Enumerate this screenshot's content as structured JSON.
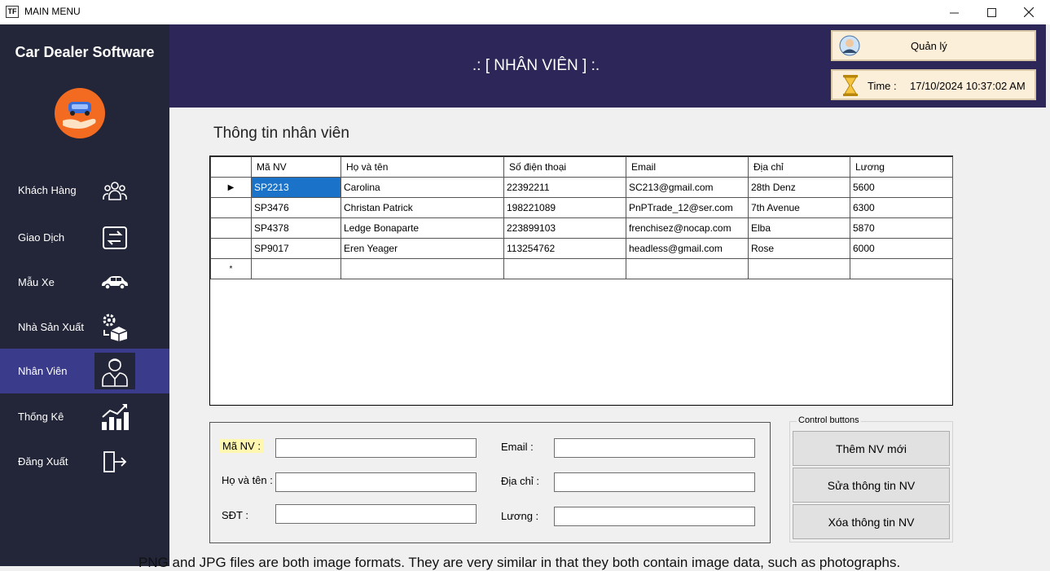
{
  "window": {
    "title": "MAIN MENU",
    "icon_label": "TF",
    "minimize": "—",
    "maximize": "☐",
    "close": "✕"
  },
  "sidebar": {
    "brand": "Car Dealer Software",
    "items": [
      {
        "label": "Khách Hàng",
        "icon": "customers-icon"
      },
      {
        "label": "Giao Dịch",
        "icon": "transactions-icon"
      },
      {
        "label": "Mẫu Xe",
        "icon": "car-icon"
      },
      {
        "label": "Nhà Sản Xuất",
        "icon": "manufacturer-icon"
      },
      {
        "label": "Nhân Viên",
        "icon": "employee-icon",
        "active": true
      },
      {
        "label": "Thống Kê",
        "icon": "statistics-icon"
      },
      {
        "label": "Đăng Xuất",
        "icon": "logout-icon"
      }
    ]
  },
  "header": {
    "title": ".: [ NHÂN VIÊN ] :.",
    "user_role": "Quản lý",
    "time_label": "Time :",
    "time_value": "17/10/2024 10:37:02 AM"
  },
  "main": {
    "section_title": "Thông tin nhân viên",
    "table": {
      "columns": [
        "Mã NV",
        "Họ và tên",
        "Số điện thoại",
        "Email",
        "Địa chỉ",
        "Lương"
      ],
      "rows": [
        [
          "SP2213",
          "Carolina",
          "22392211",
          "SC213@gmail.com",
          "28th Denz",
          "5600"
        ],
        [
          "SP3476",
          "Christan Patrick",
          "198221089",
          "PnPTrade_12@ser.com",
          "7th Avenue",
          "6300"
        ],
        [
          "SP4378",
          "Ledge Bonaparte",
          "223899103",
          "frenchisez@nocap.com",
          "Elba",
          "5870"
        ],
        [
          "SP9017",
          "Eren Yeager",
          "113254762",
          "headless@gmail.com",
          "Rose",
          "6000"
        ]
      ],
      "current_row_marker": "▶",
      "new_row_marker": "*"
    }
  },
  "form": {
    "ma_nv_label": "Mã NV :",
    "ho_ten_label": "Họ và tên :",
    "sdt_label": "SĐT :",
    "email_label": "Email :",
    "dia_chi_label": "Địa chỉ :",
    "luong_label": "Lương :"
  },
  "controls": {
    "legend": "Control buttons",
    "add": "Thêm NV mới",
    "edit": "Sửa thông tin NV",
    "delete": "Xóa thông tin NV"
  },
  "footer_text": "PNG and JPG files are both image formats. They are very similar in that they both contain image data, such as photographs.",
  "colors": {
    "sidebar_bg": "#232538",
    "header_bg": "#2d2759",
    "active_item_bg": "#3b3b8c",
    "selected_cell": "#1a73c8",
    "logo_orange": "#f26b21",
    "info_box_bg": "#fcefd9",
    "label_highlight": "#fff7b0"
  }
}
